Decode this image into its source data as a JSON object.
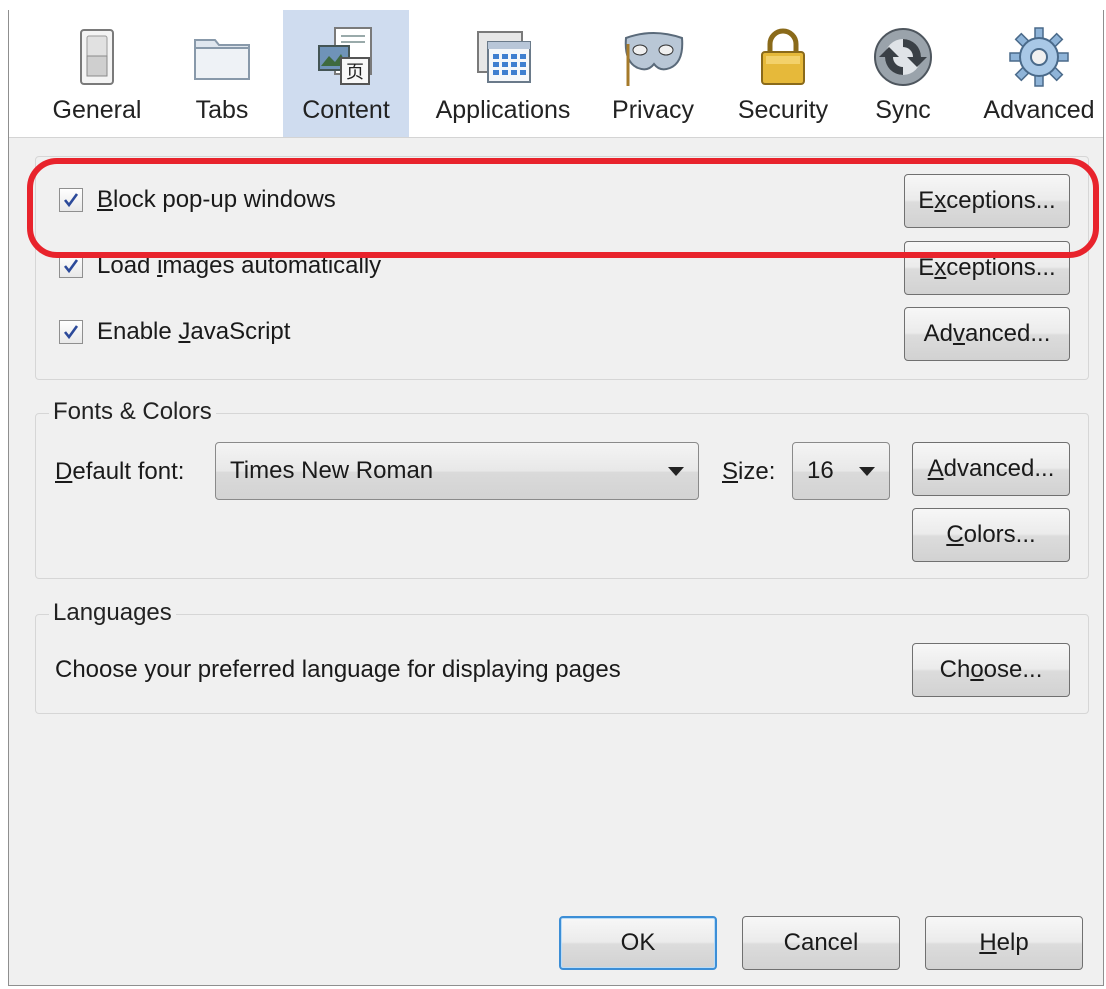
{
  "toolbar": {
    "items": [
      {
        "label": "General",
        "icon": "switch-icon",
        "selected": false
      },
      {
        "label": "Tabs",
        "icon": "folder-icon",
        "selected": false
      },
      {
        "label": "Content",
        "icon": "content-page-icon",
        "selected": true
      },
      {
        "label": "Applications",
        "icon": "applications-window-icon",
        "selected": false
      },
      {
        "label": "Privacy",
        "icon": "mask-icon",
        "selected": false
      },
      {
        "label": "Security",
        "icon": "padlock-icon",
        "selected": false
      },
      {
        "label": "Sync",
        "icon": "sync-icon",
        "selected": false
      },
      {
        "label": "Advanced",
        "icon": "gear-icon",
        "selected": false
      }
    ]
  },
  "content": {
    "popup": {
      "label_ul": "B",
      "label_rest": "lock pop-up windows",
      "checked": true,
      "button_ul": "x",
      "button_pre": "E",
      "button_post": "ceptions..."
    },
    "images": {
      "label_pre": "Load ",
      "label_ul": "i",
      "label_post": "mages automatically",
      "checked": true,
      "button_ul": "x",
      "button_pre": "E",
      "button_post": "ceptions..."
    },
    "javascript": {
      "label_pre": "Enable ",
      "label_ul": "J",
      "label_post": "avaScript",
      "checked": true,
      "button_pre": "Ad",
      "button_ul": "v",
      "button_post": "anced..."
    }
  },
  "fonts": {
    "legend": "Fonts & Colors",
    "default_font_ul": "D",
    "default_font_rest": "efault font:",
    "default_font_value": "Times New Roman",
    "size_ul": "S",
    "size_rest": "ize:",
    "size_value": "16",
    "advanced_ul": "A",
    "advanced_rest": "dvanced...",
    "colors_ul": "C",
    "colors_rest": "olors..."
  },
  "languages": {
    "legend": "Languages",
    "description": "Choose your preferred language for displaying pages",
    "choose_pre": "Ch",
    "choose_ul": "o",
    "choose_post": "ose..."
  },
  "footer": {
    "ok": "OK",
    "cancel": "Cancel",
    "help_ul": "H",
    "help_rest": "elp"
  },
  "colors": {
    "highlight": "#e8232c",
    "selected_tab": "#cfdcef",
    "default_button_border": "#3c8ed6"
  }
}
